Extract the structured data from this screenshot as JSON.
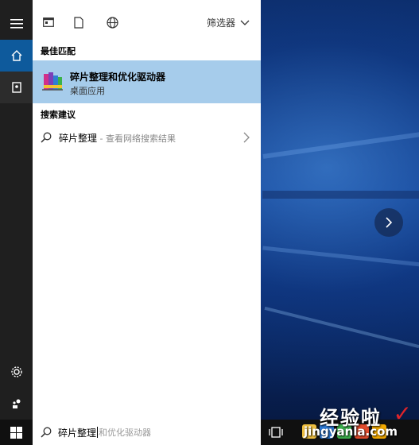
{
  "toolbar": {
    "filter_label": "筛选器"
  },
  "sections": {
    "best_match": "最佳匹配",
    "search_suggestions": "搜索建议"
  },
  "best_result": {
    "title": "碎片整理和优化驱动器",
    "subtitle": "桌面应用"
  },
  "suggestion": {
    "query": "碎片整理",
    "hint": " - 查看网络搜索结果"
  },
  "searchbox": {
    "typed": "碎片整理",
    "autocomplete": "和优化驱动器"
  },
  "watermark": {
    "title": "经验啦",
    "url": "jingyanla.com"
  },
  "colors": {
    "highlight": "#a6cceb",
    "rail_active": "#0e5a9c",
    "rail_bg": "#1f1f1f"
  }
}
